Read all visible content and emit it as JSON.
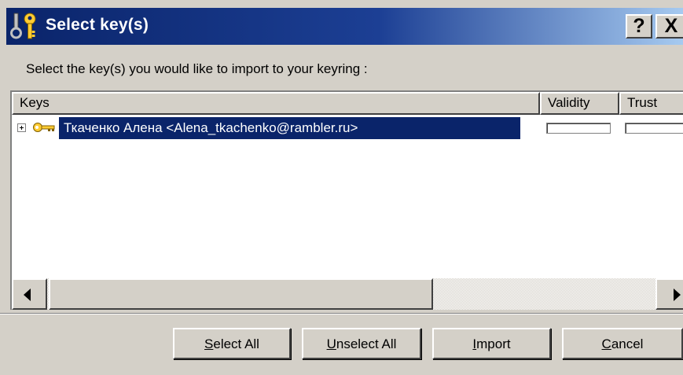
{
  "window": {
    "title": "Select key(s)",
    "help_label": "?",
    "close_label": "X",
    "title_gradient": [
      "#0a246a",
      "#a6caf0"
    ]
  },
  "instruction": "Select the key(s) you would like to import to your keyring :",
  "list": {
    "columns": [
      "Keys",
      "Validity",
      "Trust"
    ],
    "rows": [
      {
        "expand_icon": "plus-box-icon",
        "icon": "key-icon",
        "label": "Ткаченко Алена <Alena_tkachenko@rambler.ru>",
        "selected": true,
        "validity": 0,
        "trust": 0
      }
    ],
    "selection_color": "#0a246a"
  },
  "buttons": {
    "select_all": {
      "accel": "S",
      "rest": "elect All"
    },
    "unselect_all": {
      "accel": "U",
      "rest": "nselect All"
    },
    "import": {
      "accel": "I",
      "rest": "mport"
    },
    "cancel": {
      "accel": "C",
      "rest": "ancel"
    }
  }
}
